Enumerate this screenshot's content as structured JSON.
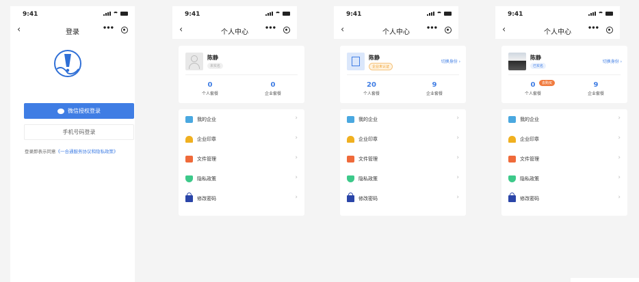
{
  "status_bar": {
    "time": "9:41"
  },
  "screens": {
    "login": {
      "title": "登录",
      "back": "‹",
      "wechat_login": "微信授权登录",
      "phone_login": "手机号码登录",
      "agreement_prefix": "登录即表示同意",
      "agreement_link": "《一合通服务协议和隐私政策》"
    },
    "profile1": {
      "title": "个人中心",
      "name": "陈静",
      "tag": "未实名",
      "stats": [
        {
          "num": "0",
          "label": "个人套餐"
        },
        {
          "num": "0",
          "label": "企业套餐"
        }
      ]
    },
    "profile2": {
      "title": "个人中心",
      "name": "陈静",
      "tag": "企业未认证",
      "switch": "切换身份 ›",
      "stats": [
        {
          "num": "20",
          "label": "个人套餐"
        },
        {
          "num": "9",
          "label": "企业套餐"
        }
      ]
    },
    "profile3": {
      "title": "个人中心",
      "name": "陈静",
      "tag": "已实名",
      "switch": "切换身份 ›",
      "badge": "去购买",
      "stats": [
        {
          "num": "0",
          "label": "个人套餐"
        },
        {
          "num": "9",
          "label": "企业套餐"
        }
      ]
    }
  },
  "menu": [
    {
      "label": "我的企业",
      "icon": "company-icon"
    },
    {
      "label": "企业印章",
      "icon": "seal-icon"
    },
    {
      "label": "文件管理",
      "icon": "folder-icon"
    },
    {
      "label": "隐私政策",
      "icon": "shield-icon"
    },
    {
      "label": "修改密码",
      "icon": "lock-icon"
    }
  ],
  "colors": {
    "accent": "#3f7de4",
    "background": "#f4f4f4",
    "badge": "#f07b3f"
  }
}
